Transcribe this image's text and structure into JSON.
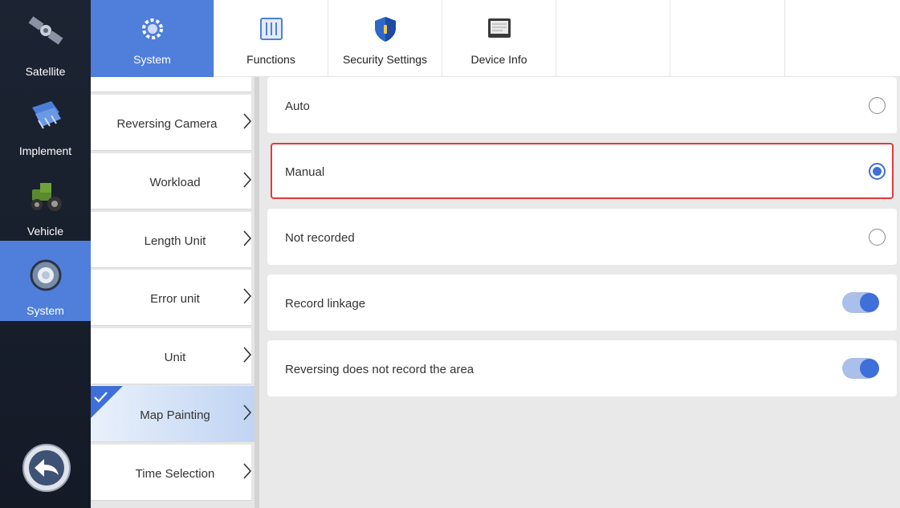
{
  "nav": {
    "items": [
      {
        "label": "Satellite",
        "icon": "satellite-icon"
      },
      {
        "label": "Implement",
        "icon": "implement-icon"
      },
      {
        "label": "Vehicle",
        "icon": "tractor-icon"
      },
      {
        "label": "System",
        "icon": "gear-icon",
        "active": true
      }
    ],
    "back_icon": "back-arrow-icon"
  },
  "tabs": [
    {
      "label": "System",
      "icon": "gear-icon",
      "active": true
    },
    {
      "label": "Functions",
      "icon": "sliders-icon"
    },
    {
      "label": "Security Settings",
      "icon": "shield-icon"
    },
    {
      "label": "Device Info",
      "icon": "monitor-icon"
    }
  ],
  "submenu": [
    {
      "label": "Reversing Camera"
    },
    {
      "label": "Workload"
    },
    {
      "label": "Length Unit"
    },
    {
      "label": "Error unit"
    },
    {
      "label": "Unit"
    },
    {
      "label": "Map Painting",
      "active": true
    },
    {
      "label": "Time Selection"
    }
  ],
  "options": {
    "radio": [
      {
        "label": "Auto",
        "selected": false
      },
      {
        "label": "Manual",
        "selected": true
      },
      {
        "label": "Not recorded",
        "selected": false
      }
    ],
    "toggles": [
      {
        "label": "Record linkage",
        "on": true
      },
      {
        "label": "Reversing does not record the area",
        "on": true
      }
    ]
  },
  "colors": {
    "accent": "#4f7fdb",
    "highlight_border": "#e3393c",
    "nav_bg": "#1c2433"
  }
}
